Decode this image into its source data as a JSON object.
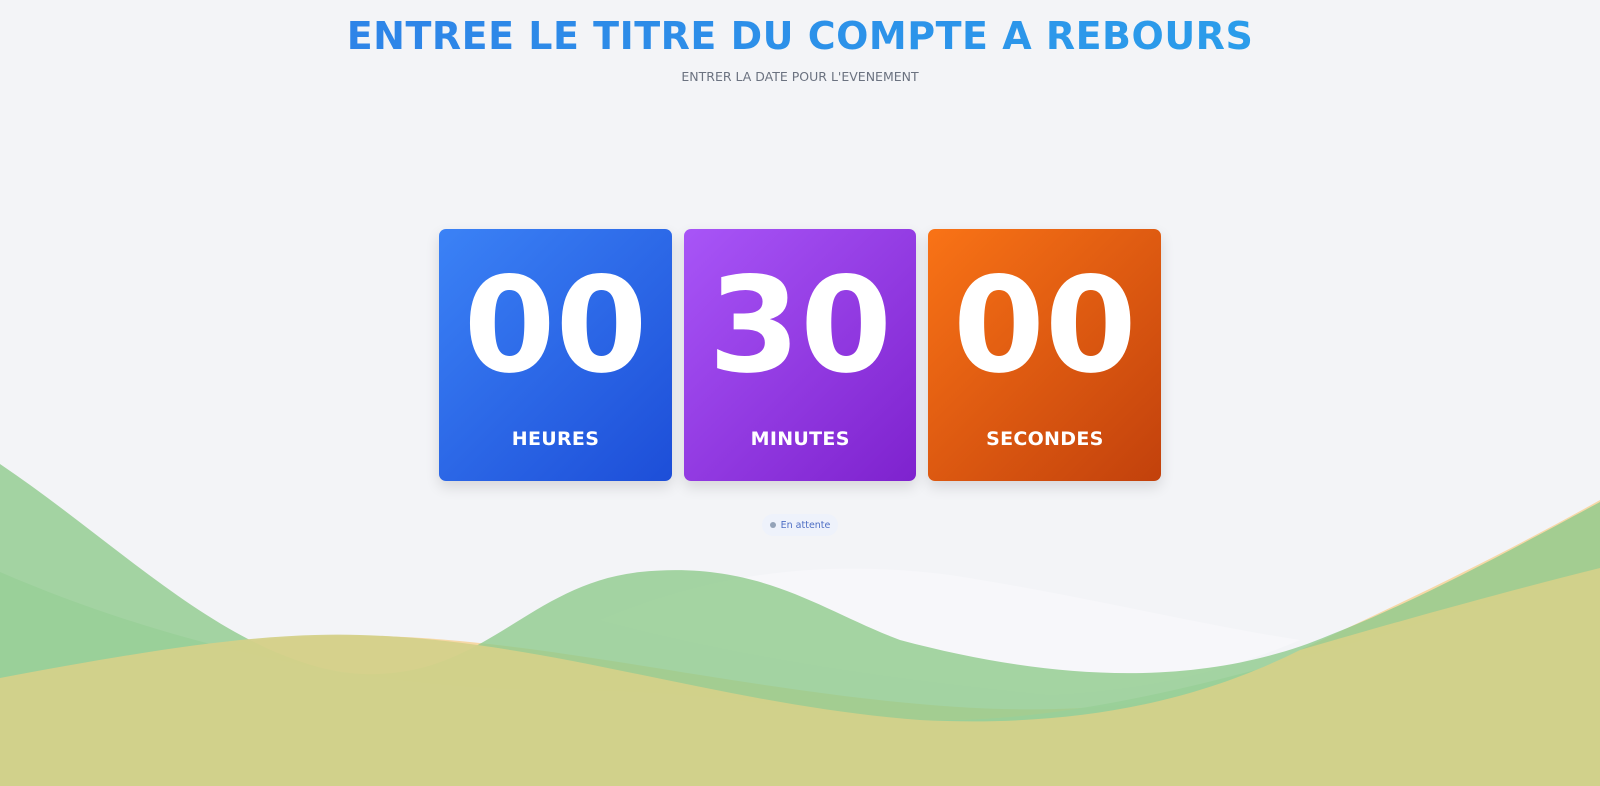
{
  "header": {
    "title": "ENTREE LE TITRE DU COMPTE A REBOURS",
    "subtitle": "ENTRER LA DATE POUR L'EVENEMENT"
  },
  "countdown": {
    "hours": {
      "value": "00",
      "label": "HEURES",
      "color_from": "#3b82f6",
      "color_to": "#1d4ed8"
    },
    "minutes": {
      "value": "30",
      "label": "MINUTES",
      "color_from": "#a855f7",
      "color_to": "#7e22ce"
    },
    "seconds": {
      "value": "00",
      "label": "SECONDES",
      "color_from": "#f97316",
      "color_to": "#c2410c"
    }
  },
  "status": {
    "text": "En attente",
    "icon": "status-dot-icon"
  },
  "theme": {
    "background": "#f3f4f7",
    "wave_green": "#8fcb8c",
    "wave_light_green": "#c2e3c8",
    "wave_orange": "#f6d59c",
    "wave_olive": "#d4d18a"
  }
}
